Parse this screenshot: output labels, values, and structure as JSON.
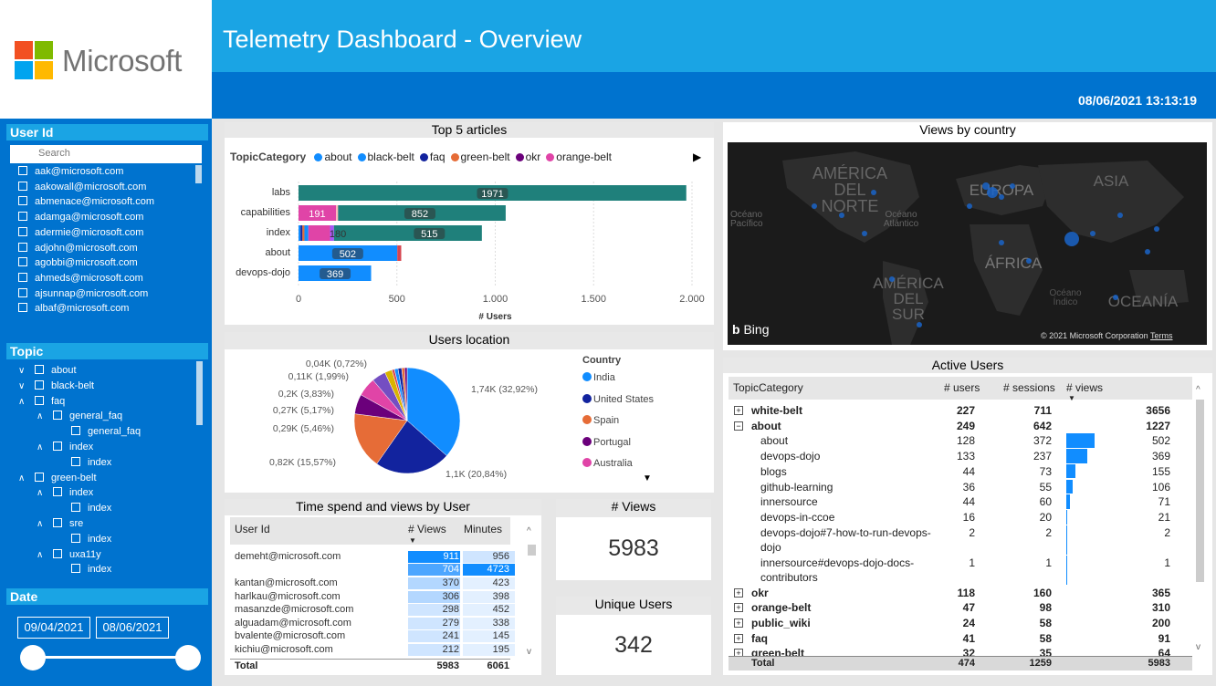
{
  "brand": {
    "name": "Microsoft",
    "colors": [
      "#f25022",
      "#7fba00",
      "#00a4ef",
      "#ffb900"
    ]
  },
  "header": {
    "title": "Telemetry Dashboard - Overview",
    "datetime": "08/06/2021 13:13:19"
  },
  "userid": {
    "title": "User Id",
    "search_placeholder": "Search",
    "users": [
      "aak@microsoft.com",
      "aakowall@microsoft.com",
      "abmenace@microsoft.com",
      "adamga@microsoft.com",
      "adermie@microsoft.com",
      "adjohn@microsoft.com",
      "agobbi@microsoft.com",
      "ahmeds@microsoft.com",
      "ajsunnap@microsoft.com",
      "albaf@microsoft.com"
    ]
  },
  "topic": {
    "title": "Topic",
    "items": [
      {
        "label": "about",
        "indent": 0,
        "chevron": "down"
      },
      {
        "label": "black-belt",
        "indent": 0,
        "chevron": "down"
      },
      {
        "label": "faq",
        "indent": 0,
        "chevron": "up"
      },
      {
        "label": "general_faq",
        "indent": 1,
        "chevron": "up"
      },
      {
        "label": "general_faq",
        "indent": 2,
        "chevron": ""
      },
      {
        "label": "index",
        "indent": 1,
        "chevron": "up"
      },
      {
        "label": "index",
        "indent": 2,
        "chevron": ""
      },
      {
        "label": "green-belt",
        "indent": 0,
        "chevron": "up"
      },
      {
        "label": "index",
        "indent": 1,
        "chevron": "up"
      },
      {
        "label": "index",
        "indent": 2,
        "chevron": ""
      },
      {
        "label": "sre",
        "indent": 1,
        "chevron": "up"
      },
      {
        "label": "index",
        "indent": 2,
        "chevron": ""
      },
      {
        "label": "uxa11y",
        "indent": 1,
        "chevron": "up"
      },
      {
        "label": "index",
        "indent": 2,
        "chevron": ""
      }
    ]
  },
  "date": {
    "title": "Date",
    "from": "09/04/2021",
    "to": "08/06/2021"
  },
  "top5": {
    "title": "Top 5 articles",
    "legend_title": "TopicCategory"
  },
  "chart_data": [
    {
      "type": "bar",
      "title": "Top 5 articles",
      "legend": [
        {
          "name": "about",
          "color": "#118dff"
        },
        {
          "name": "black-belt",
          "color": "#118dff"
        },
        {
          "name": "faq",
          "color": "#12239e"
        },
        {
          "name": "green-belt",
          "color": "#e66c37"
        },
        {
          "name": "okr",
          "color": "#6b007b"
        },
        {
          "name": "orange-belt",
          "color": "#e044a7"
        }
      ],
      "categories": [
        "labs",
        "capabilities",
        "index",
        "about",
        "devops-dojo"
      ],
      "values": [
        1971,
        1053,
        932,
        530,
        369
      ],
      "labels": [
        "1971",
        "852",
        "515",
        "502",
        "369"
      ],
      "xlabel": "# Users",
      "xticks": [
        "0",
        "500",
        "1.000",
        "1.500",
        "2.000"
      ],
      "xlim": [
        0,
        2000
      ]
    },
    {
      "type": "pie",
      "title": "Users location",
      "legend_title": "Country",
      "legend": [
        {
          "name": "India",
          "color": "#118dff"
        },
        {
          "name": "United States",
          "color": "#12239e"
        },
        {
          "name": "Spain",
          "color": "#e66c37"
        },
        {
          "name": "Portugal",
          "color": "#6b007b"
        },
        {
          "name": "Australia",
          "color": "#e044a7"
        }
      ],
      "values": [
        32.92,
        20.84,
        15.57,
        5.46,
        5.17,
        3.83,
        1.99,
        0.72
      ],
      "labels": [
        "1,74K (32,92%)",
        "1,1K (20,84%)",
        "0,82K (15,57%)",
        "0,29K (5,46%)",
        "0,27K (5,17%)",
        "0,2K (3,83%)",
        "0,11K (1,99%)",
        "0,04K (0,72%)"
      ]
    }
  ],
  "map": {
    "title": "Views by country",
    "labels": [
      "AMÉRICA\nDEL\nNORTE",
      "EUROPA",
      "ASIA",
      "Océano\nPacífico",
      "Océano\nAtlántico",
      "ÁFRICA",
      "AMÉRICA\nDEL\nSUR",
      "Océano\nÍndico",
      "OCEANÍA"
    ],
    "bing": "Bing",
    "copyright": "© 2021 Microsoft Corporation",
    "terms": "Terms"
  },
  "timespend": {
    "title": "Time spend and views by User",
    "headers": [
      "User Id",
      "# Views",
      "Minutes"
    ],
    "rows": [
      [
        "demeht@microsoft.com",
        "911",
        "956"
      ],
      [
        "",
        "704",
        "4723"
      ],
      [
        "kantan@microsoft.com",
        "370",
        "423"
      ],
      [
        "harlkau@microsoft.com",
        "306",
        "398"
      ],
      [
        "masanzde@microsoft.com",
        "298",
        "452"
      ],
      [
        "alguadam@microsoft.com",
        "279",
        "338"
      ],
      [
        "bvalente@microsoft.com",
        "241",
        "145"
      ],
      [
        "kichiu@microsoft.com",
        "212",
        "195"
      ]
    ],
    "total": [
      "Total",
      "5983",
      "6061"
    ]
  },
  "views": {
    "title": "# Views",
    "value": "5983"
  },
  "unique": {
    "title": "Unique Users",
    "value": "342"
  },
  "active": {
    "title": "Active Users",
    "headers": [
      "TopicCategory",
      "# users",
      "# sessions",
      "# views"
    ],
    "rows": [
      {
        "l": "white-belt",
        "u": "227",
        "s": "711",
        "v": "3656",
        "b": true,
        "e": "+"
      },
      {
        "l": "about",
        "u": "249",
        "s": "642",
        "v": "1227",
        "b": true,
        "e": "-"
      },
      {
        "l": "about",
        "u": "128",
        "s": "372",
        "v": "502"
      },
      {
        "l": "devops-dojo",
        "u": "133",
        "s": "237",
        "v": "369"
      },
      {
        "l": "blogs",
        "u": "44",
        "s": "73",
        "v": "155"
      },
      {
        "l": "github-learning",
        "u": "36",
        "s": "55",
        "v": "106"
      },
      {
        "l": "innersource",
        "u": "44",
        "s": "60",
        "v": "71"
      },
      {
        "l": "devops-in-ccoe",
        "u": "16",
        "s": "20",
        "v": "21"
      },
      {
        "l": "devops-dojo#7-how-to-run-devops-",
        "l2": "dojo",
        "u": "2",
        "s": "2",
        "v": "2"
      },
      {
        "l": "innersource#devops-dojo-docs-",
        "l2": "contributors",
        "u": "1",
        "s": "1",
        "v": "1"
      },
      {
        "l": "okr",
        "u": "118",
        "s": "160",
        "v": "365",
        "b": true,
        "e": "+"
      },
      {
        "l": "orange-belt",
        "u": "47",
        "s": "98",
        "v": "310",
        "b": true,
        "e": "+"
      },
      {
        "l": "public_wiki",
        "u": "24",
        "s": "58",
        "v": "200",
        "b": true,
        "e": "+"
      },
      {
        "l": "faq",
        "u": "41",
        "s": "58",
        "v": "91",
        "b": true,
        "e": "+"
      },
      {
        "l": "green-belt",
        "u": "32",
        "s": "35",
        "v": "64",
        "b": true,
        "e": "+"
      }
    ],
    "total": [
      "Total",
      "474",
      "1259",
      "5983"
    ]
  }
}
